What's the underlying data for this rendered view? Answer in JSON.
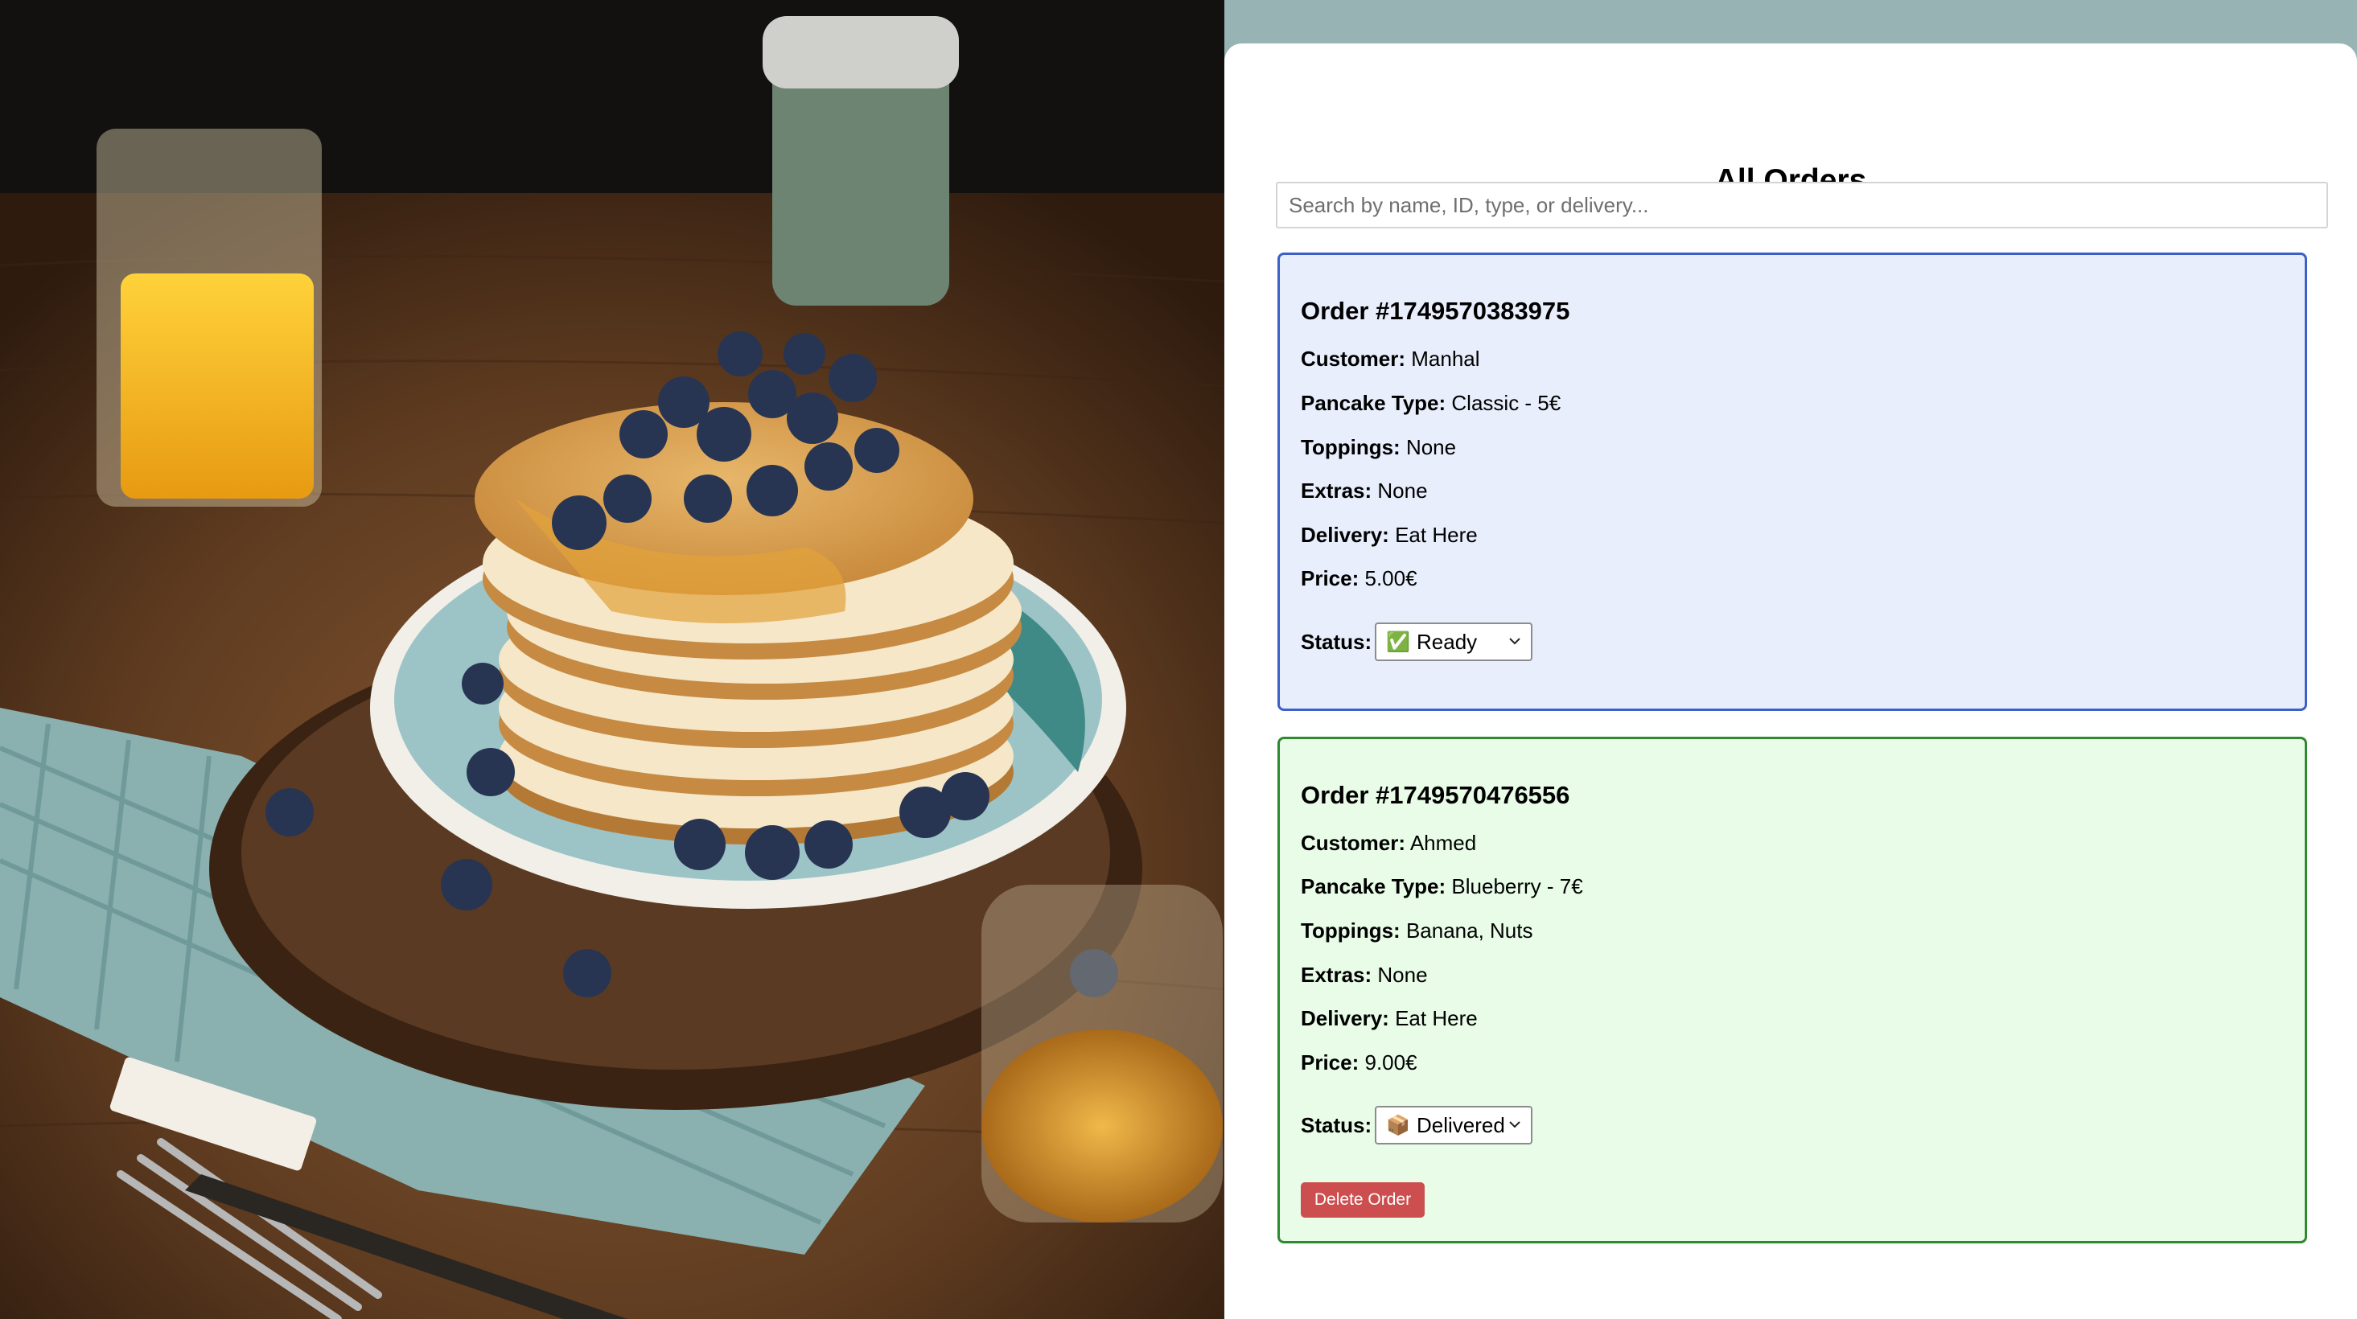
{
  "page": {
    "title": "All Orders",
    "search_placeholder": "Search by name, ID, type, or delivery...",
    "hero_image": "pancakes-with-blueberries-photo"
  },
  "colors": {
    "background": "#97b3b3",
    "card_ready_bg": "#e8eefc",
    "card_ready_border": "#3c5fc8",
    "card_delivered_bg": "#e8fce8",
    "card_delivered_border": "#2e8a2e",
    "delete_button": "#cc4e4e"
  },
  "labels": {
    "customer": "Customer:",
    "pancake_type": "Pancake Type:",
    "toppings": "Toppings:",
    "extras": "Extras:",
    "delivery": "Delivery:",
    "price": "Price:",
    "status": "Status:"
  },
  "orders": [
    {
      "heading": "Order #1749570383975",
      "customer": "Manhal",
      "pancake_type": "Classic - 5€",
      "toppings": "None",
      "extras": "None",
      "delivery": "Eat Here",
      "price": "5.00€",
      "status_icon": "✅",
      "status": "Ready"
    },
    {
      "heading": "Order #1749570476556",
      "customer": "Ahmed",
      "pancake_type": "Blueberry - 7€",
      "toppings": "Banana, Nuts",
      "extras": "None",
      "delivery": "Eat Here",
      "price": "9.00€",
      "status_icon": "📦",
      "status": "Delivered",
      "delete_label": "Delete Order"
    }
  ]
}
